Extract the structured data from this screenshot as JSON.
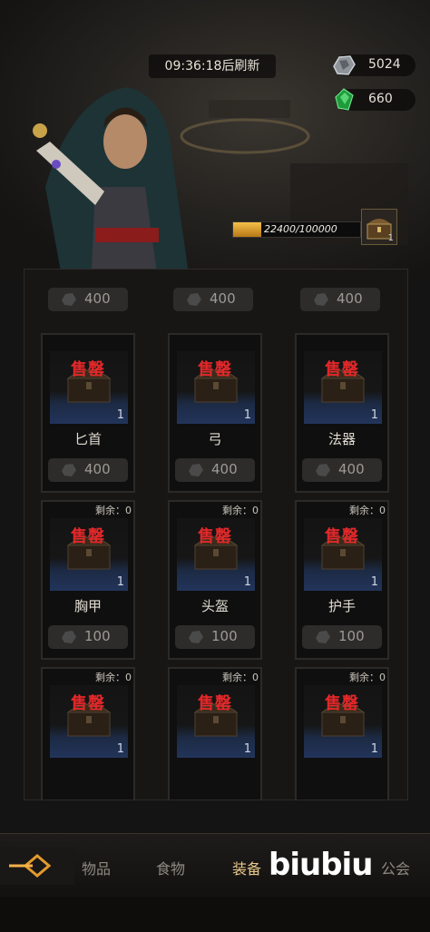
{
  "header": {
    "refresh_text": "09:36:18后刷新",
    "silver_amount": "5024",
    "gem_amount": "660",
    "progress_text": "22400/100000",
    "progress_fraction": 0.224,
    "chest_count": "1"
  },
  "top_row_prices": [
    "400",
    "400",
    "400"
  ],
  "cards": [
    {
      "remain": "",
      "sold": "售罄",
      "count": "1",
      "name": "匕首",
      "price": "400"
    },
    {
      "remain": "",
      "sold": "售罄",
      "count": "1",
      "name": "弓",
      "price": "400"
    },
    {
      "remain": "",
      "sold": "售罄",
      "count": "1",
      "name": "法器",
      "price": "400"
    },
    {
      "remain": "剩余：0",
      "sold": "售罄",
      "count": "1",
      "name": "胸甲",
      "price": "100"
    },
    {
      "remain": "剩余：0",
      "sold": "售罄",
      "count": "1",
      "name": "头盔",
      "price": "100"
    },
    {
      "remain": "剩余：0",
      "sold": "售罄",
      "count": "1",
      "name": "护手",
      "price": "100"
    },
    {
      "remain": "剩余：0",
      "sold": "售罄",
      "count": "1",
      "name": "",
      "price": ""
    },
    {
      "remain": "剩余：0",
      "sold": "售罄",
      "count": "1",
      "name": "",
      "price": ""
    },
    {
      "remain": "剩余：0",
      "sold": "售罄",
      "count": "1",
      "name": "",
      "price": ""
    }
  ],
  "tabs": [
    {
      "label": "物品",
      "active": false
    },
    {
      "label": "食物",
      "active": false
    },
    {
      "label": "装备",
      "active": true
    },
    {
      "label": "公会",
      "active": false
    }
  ],
  "watermark": "biubiu",
  "colors": {
    "sold_out": "#e3282a",
    "active_tab": "#e8c88a",
    "progress": "#f5c04a"
  }
}
